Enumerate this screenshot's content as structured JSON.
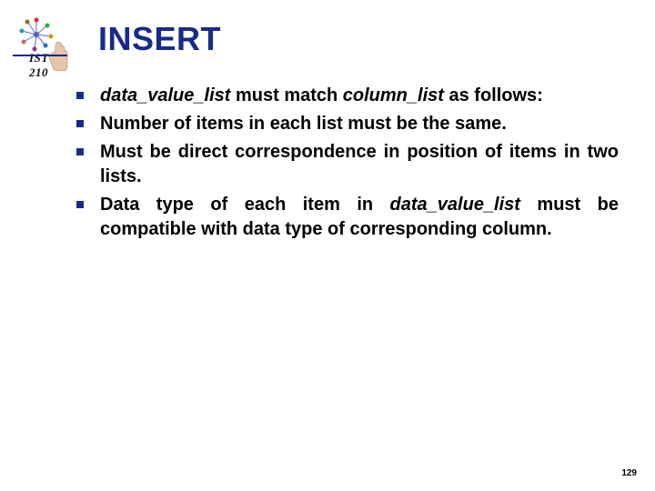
{
  "logo": {
    "label": "IST 210"
  },
  "title": "INSERT",
  "bullets": [
    {
      "segments": [
        {
          "text": "data_value_list",
          "italic": true
        },
        {
          "text": " must match ",
          "italic": false
        },
        {
          "text": "column_list",
          "italic": true
        },
        {
          "text": " as follows:",
          "italic": false
        }
      ]
    },
    {
      "segments": [
        {
          "text": "Number of items in each list must be the same.",
          "italic": false
        }
      ]
    },
    {
      "segments": [
        {
          "text": "Must be direct correspondence in position of items in two lists.",
          "italic": false
        }
      ]
    },
    {
      "segments": [
        {
          "text": "Data type of each item in ",
          "italic": false
        },
        {
          "text": "data_value_list",
          "italic": true
        },
        {
          "text": " must be compatible with data type of corresponding column.",
          "italic": false
        }
      ]
    }
  ],
  "page_number": "129"
}
